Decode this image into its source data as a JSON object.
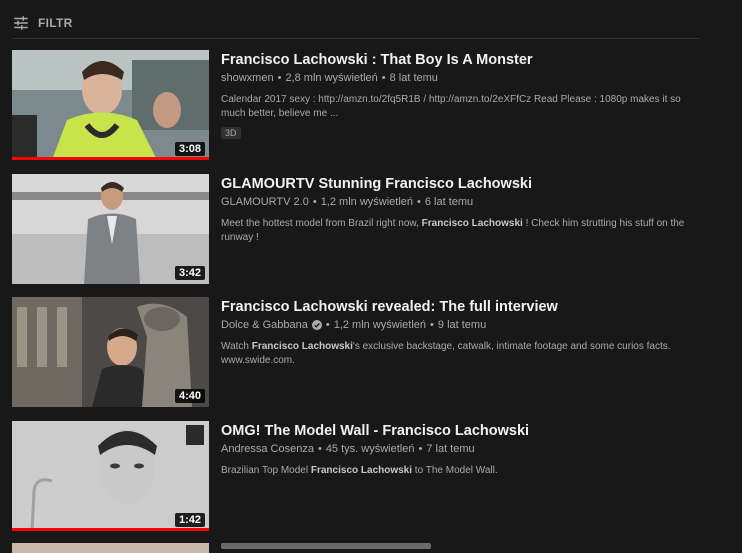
{
  "filter": {
    "label": "FILTR"
  },
  "accent_color": "#ff0000",
  "results": [
    {
      "title": "Francisco Lachowski : That Boy Is A Monster",
      "channel": "showxmen",
      "views": "2,8 mln wyświetleń",
      "age": "8 lat temu",
      "desc_line1": "Calendar 2017 sexy : http://amzn.to/2fq5R1B / http://amzn.to/2eXFfCz Read Please : 1080p makes it so",
      "desc_line2": "much better, believe me ...",
      "badge": "3D",
      "duration": "3:08",
      "watched_fraction": 1.0
    },
    {
      "title": "GLAMOURTV Stunning Francisco Lachowski",
      "channel": "GLAMOURTV 2.0",
      "views": "1,2 mln wyświetleń",
      "age": "6 lat temu",
      "desc_pre": "Meet the hottest model from Brazil right now, ",
      "desc_bold": "Francisco Lachowski",
      "desc_post": " ! Check him strutting his stuff on the",
      "desc_line2": "runway !",
      "duration": "3:42"
    },
    {
      "title": "Francisco Lachowski revealed: The full interview",
      "channel": "Dolce & Gabbana",
      "views": "1,2 mln wyświetleń",
      "age": "9 lat temu",
      "desc_pre": "Watch ",
      "desc_bold": "Francisco Lachowski",
      "desc_post": "'s exclusive backstage, catwalk, intimate footage and some curios facts.",
      "desc_line2": "www.swide.com.",
      "duration": "4:40"
    },
    {
      "title": "OMG! The Model Wall - Francisco Lachowski",
      "channel": "Andressa Cosenza",
      "views": "45 tys. wyświetleń",
      "age": "7 lat temu",
      "desc_pre": "Brazilian Top Model ",
      "desc_bold": "Francisco Lachowski",
      "desc_post": " to The Model Wall.",
      "duration": "1:42",
      "watched_fraction": 1.0
    }
  ]
}
